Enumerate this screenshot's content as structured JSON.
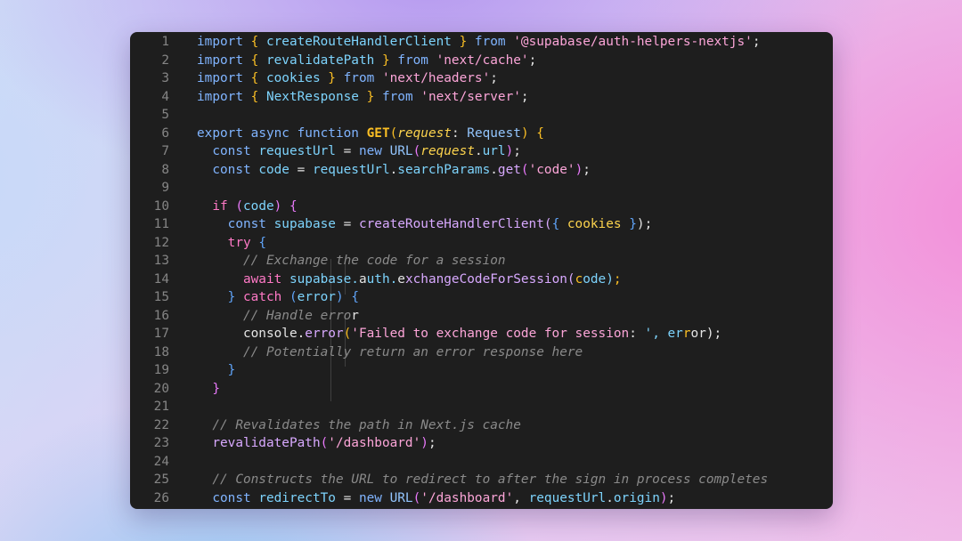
{
  "editor": {
    "lines": [
      {
        "n": "1",
        "text": "import { createRouteHandlerClient } from '@supabase/auth-helpers-nextjs';"
      },
      {
        "n": "2",
        "text": "import { revalidatePath } from 'next/cache';"
      },
      {
        "n": "3",
        "text": "import { cookies } from 'next/headers';"
      },
      {
        "n": "4",
        "text": "import { NextResponse } from 'next/server';"
      },
      {
        "n": "5",
        "text": ""
      },
      {
        "n": "6",
        "text": "export async function GET(request: Request) {"
      },
      {
        "n": "7",
        "text": "  const requestUrl = new URL(request.url);"
      },
      {
        "n": "8",
        "text": "  const code = requestUrl.searchParams.get('code');"
      },
      {
        "n": "9",
        "text": ""
      },
      {
        "n": "10",
        "text": "  if (code) {"
      },
      {
        "n": "11",
        "text": "    const supabase = createRouteHandlerClient({ cookies });"
      },
      {
        "n": "12",
        "text": "    try {"
      },
      {
        "n": "13",
        "text": "      // Exchange the code for a session"
      },
      {
        "n": "14",
        "text": "      await supabase.auth.exchangeCodeForSession(code);"
      },
      {
        "n": "15",
        "text": "    } catch (error) {"
      },
      {
        "n": "16",
        "text": "      // Handle error"
      },
      {
        "n": "17",
        "text": "      console.error('Failed to exchange code for session: ', error);"
      },
      {
        "n": "18",
        "text": "      // Potentially return an error response here"
      },
      {
        "n": "19",
        "text": "    }"
      },
      {
        "n": "20",
        "text": "  }"
      },
      {
        "n": "21",
        "text": ""
      },
      {
        "n": "22",
        "text": "  // Revalidates the path in Next.js cache"
      },
      {
        "n": "23",
        "text": "  revalidatePath('/dashboard');"
      },
      {
        "n": "24",
        "text": ""
      },
      {
        "n": "25",
        "text": "  // Constructs the URL to redirect to after the sign in process completes"
      },
      {
        "n": "26",
        "text": "  const redirectTo = new URL('/dashboard', requestUrl.origin);"
      }
    ]
  },
  "colors": {
    "editor_background": "#1e1e1e",
    "line_number": "#858585",
    "keyword": "#80b4ff",
    "control_keyword": "#ff79c6",
    "string": "#fca5d8",
    "comment": "#8a8a8a",
    "function_name": "#fbbf24"
  }
}
